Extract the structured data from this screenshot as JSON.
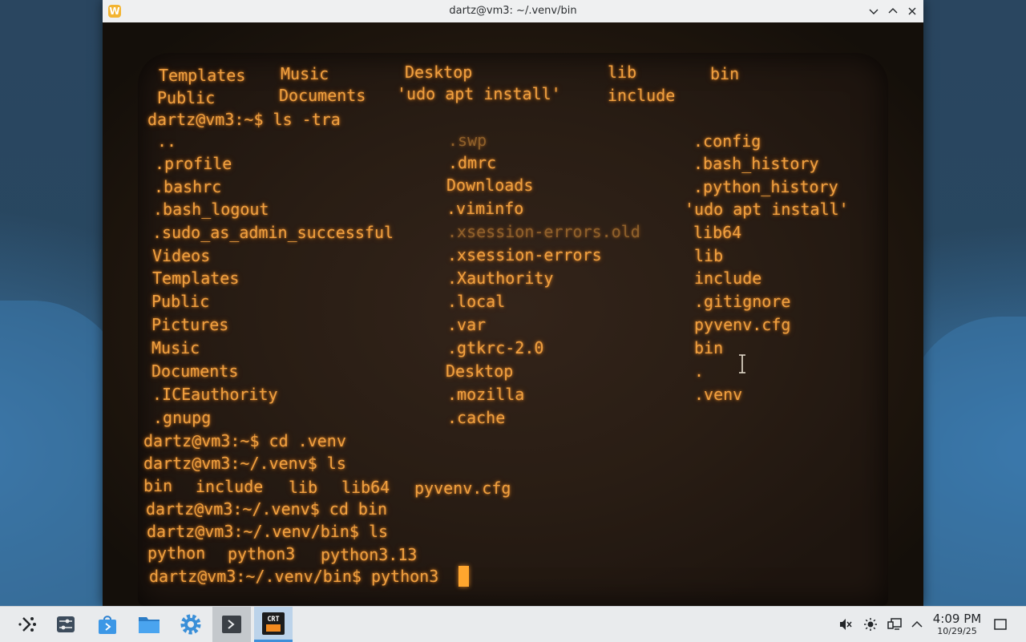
{
  "window": {
    "title": "dartz@vm3: ~/.venv/bin",
    "app_icon": "W"
  },
  "terminal": {
    "lines": [
      [
        "Templates",
        "Music",
        "Desktop",
        "lib",
        "bin"
      ],
      [
        "Public",
        "Documents",
        "'udo apt install'",
        "include"
      ],
      [
        "dartz@vm3:~$ ls -tra"
      ],
      [
        "..",
        ".swp",
        ".config"
      ],
      [
        ".profile",
        ".dmrc",
        ".bash_history"
      ],
      [
        ".bashrc",
        "Downloads",
        ".python_history"
      ],
      [
        ".bash_logout",
        ".viminfo",
        "'udo apt install'"
      ],
      [
        ".sudo_as_admin_successful",
        ".xsession-errors.old",
        "lib64"
      ],
      [
        "Videos",
        ".xsession-errors",
        "lib"
      ],
      [
        "Templates",
        ".Xauthority",
        "include"
      ],
      [
        "Public",
        ".local",
        ".gitignore"
      ],
      [
        "Pictures",
        ".var",
        "pyvenv.cfg"
      ],
      [
        "Music",
        ".gtkrc-2.0",
        "bin"
      ],
      [
        "Documents",
        "Desktop",
        "."
      ],
      [
        ".ICEauthority",
        ".mozilla",
        ".venv"
      ],
      [
        ".gnupg",
        ".cache"
      ],
      [
        "dartz@vm3:~$ cd .venv"
      ],
      [
        "dartz@vm3:~/.venv$ ls"
      ],
      [
        "bin",
        "include",
        "lib",
        "lib64",
        "pyvenv.cfg"
      ],
      [
        "dartz@vm3:~/.venv$ cd bin"
      ],
      [
        "dartz@vm3:~/.venv/bin$ ls"
      ],
      [
        "python",
        "python3",
        "python3.13"
      ],
      [
        "dartz@vm3:~/.venv/bin$ python3"
      ]
    ]
  },
  "taskbar": {
    "items": [
      {
        "name": "application-launcher",
        "icon": "launcher-icon"
      },
      {
        "name": "system-settings-panel",
        "icon": "sliders-icon"
      },
      {
        "name": "discover-store",
        "icon": "store-icon"
      },
      {
        "name": "file-manager",
        "icon": "folder-icon"
      },
      {
        "name": "settings",
        "icon": "gear-icon"
      },
      {
        "name": "terminal",
        "icon": "terminal-icon"
      },
      {
        "name": "crt-terminal",
        "icon": "crt-icon",
        "label": "CRT"
      }
    ],
    "tray": [
      "volume-muted-icon",
      "brightness-icon",
      "network-icon",
      "chevron-up-icon"
    ],
    "clock": {
      "time": "4:09 PM",
      "date": "10/29/25"
    }
  },
  "colors": {
    "phosphor": "#f0a040",
    "titlebar": "#eff0f1",
    "taskbar": "#e9ebed",
    "accent": "#3d8fd9"
  }
}
